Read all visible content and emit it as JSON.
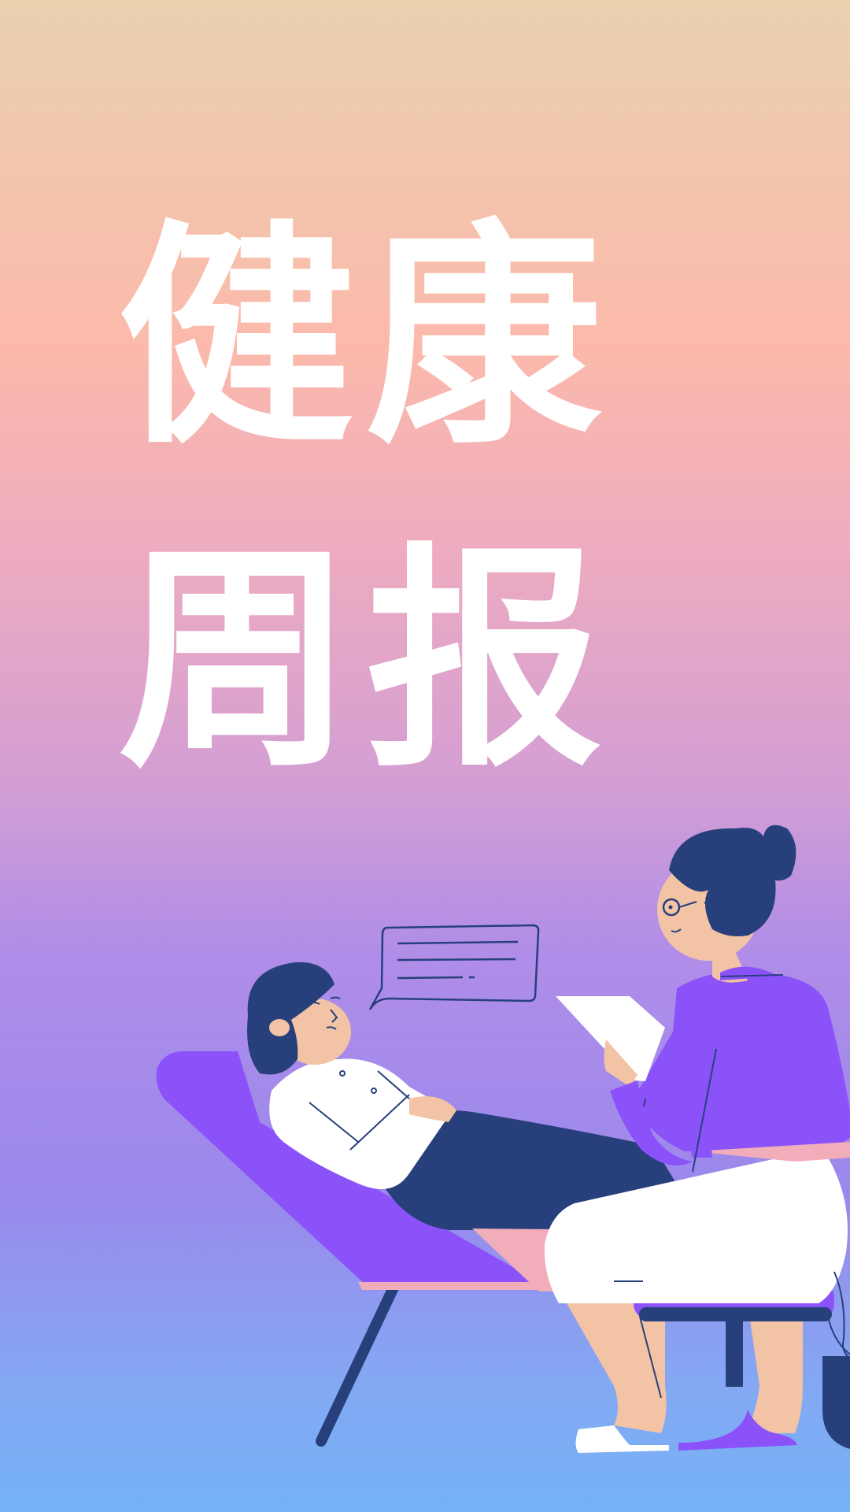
{
  "poster": {
    "title_line1": "健康",
    "title_line2": "周报",
    "illustration": "therapy-session",
    "colors": {
      "gradient_top": "#e9d1ae",
      "gradient_peach": "#fcb9ab",
      "gradient_lavender": "#b08de8",
      "gradient_bottom": "#75b2f6",
      "accent_purple": "#8c52fa",
      "navy": "#27407c",
      "skin": "#f2c3a5",
      "pink": "#f1adb9",
      "text": "#ffffff"
    }
  }
}
